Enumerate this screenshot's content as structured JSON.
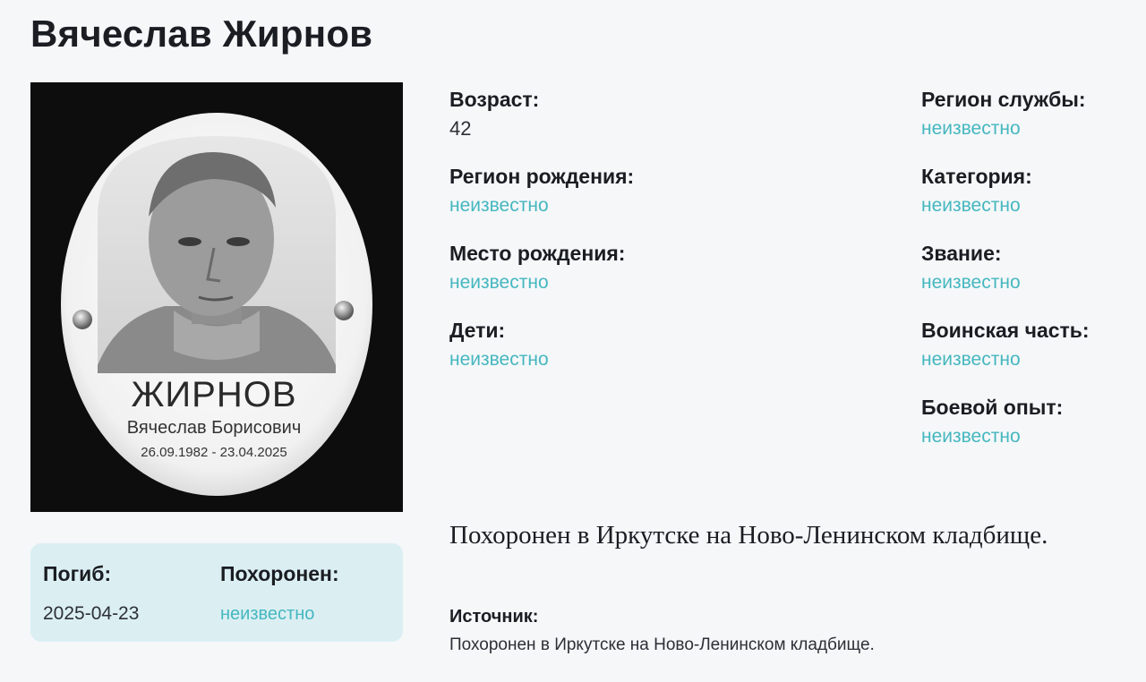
{
  "person": {
    "name": "Вячеслав Жирнов"
  },
  "photo": {
    "plaque_surname": "ЖИРНОВ",
    "plaque_fullname": "Вячеслав Борисович",
    "plaque_dates": "26.09.1982 - 23.04.2025"
  },
  "death_card": {
    "died_label": "Погиб:",
    "died_value": "2025-04-23",
    "buried_label": "Похоронен:",
    "buried_value": "неизвестно"
  },
  "fields_left": [
    {
      "label": "Возраст:",
      "value": "42"
    },
    {
      "label": "Регион рождения:",
      "value": "неизвестно"
    },
    {
      "label": "Место рождения:",
      "value": "неизвестно"
    },
    {
      "label": "Дети:",
      "value": "неизвестно"
    }
  ],
  "fields_right": [
    {
      "label": "Регион службы:",
      "value": "неизвестно"
    },
    {
      "label": "Категория:",
      "value": "неизвестно"
    },
    {
      "label": "Звание:",
      "value": "неизвестно"
    },
    {
      "label": "Воинская часть:",
      "value": "неизвестно"
    },
    {
      "label": "Боевой опыт:",
      "value": "неизвестно"
    }
  ],
  "burial_text": "Похоронен в Иркутске на Ново-Ленинском кладбище.",
  "source": {
    "label": "Источник:",
    "text": "Похоронен в Иркутске на Ново-Ленинском кладбище."
  },
  "colors": {
    "accent": "#45b7bf",
    "card_bg": "#dbeff3",
    "page_bg": "#f5f7f9",
    "text": "#1a1d22"
  }
}
